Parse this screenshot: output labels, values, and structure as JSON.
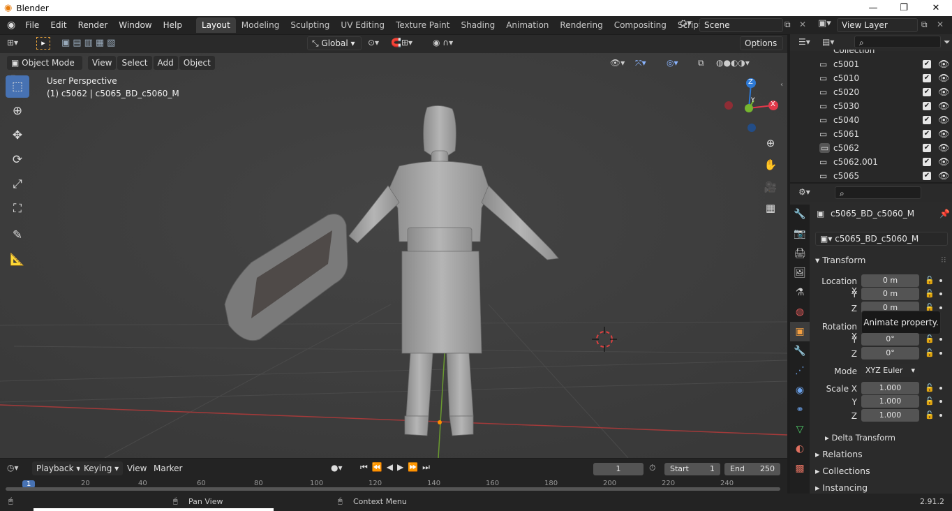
{
  "app": {
    "title": "Blender",
    "version": "2.91.2"
  },
  "menus": [
    "File",
    "Edit",
    "Render",
    "Window",
    "Help"
  ],
  "workspaces": [
    "Layout",
    "Modeling",
    "Sculpting",
    "UV Editing",
    "Texture Paint",
    "Shading",
    "Animation",
    "Rendering",
    "Compositing",
    "Scripting"
  ],
  "scene": {
    "scene_name": "Scene",
    "view_layer": "View Layer"
  },
  "toolbar": {
    "orientation": "Global",
    "options_label": "Options"
  },
  "viewport_header": {
    "mode": "Object Mode",
    "menus": [
      "View",
      "Select",
      "Add",
      "Object"
    ]
  },
  "viewport": {
    "perspective": "User Perspective",
    "object_info": "(1) c5062 | c5065_BD_c5060_M",
    "gizmo": {
      "z": "Z",
      "y": "Y",
      "x": "X"
    }
  },
  "outliner": {
    "top_partial": "Collection",
    "items": [
      "c5001",
      "c5010",
      "c5020",
      "c5030",
      "c5040",
      "c5061",
      "c5062",
      "c5062.001",
      "c5065"
    ]
  },
  "properties": {
    "object_name": "c5065_BD_c5060_M",
    "data_name": "c5065_BD_c5060_M",
    "transform_label": "Transform",
    "location_label": "Location X",
    "loc_x": "0 m",
    "loc_y": "0 m",
    "loc_z": "0 m",
    "rotation_label": "Rotation X",
    "rot_y": "0°",
    "rot_z": "0°",
    "mode_label": "Mode",
    "mode_value": "XYZ Euler",
    "scale_label": "Scale X",
    "scale_x": "1.000",
    "scale_y": "1.000",
    "scale_z": "1.000",
    "y_label": "Y",
    "z_label": "Z",
    "delta": "Delta Transform",
    "relations": "Relations",
    "collections": "Collections",
    "instancing": "Instancing",
    "tooltip": "Animate property."
  },
  "timeline": {
    "menus": [
      "Playback",
      "Keying",
      "View",
      "Marker"
    ],
    "current_frame": "1",
    "start_label": "Start",
    "start": "1",
    "end_label": "End",
    "end": "250",
    "ruler": [
      "1",
      "20",
      "40",
      "60",
      "80",
      "100",
      "120",
      "140",
      "160",
      "180",
      "200",
      "220",
      "240"
    ]
  },
  "status": {
    "pan": "Pan View",
    "context": "Context Menu",
    "version": "2.91.2"
  },
  "colors": {
    "accent": "#4772b3",
    "axis_x": "#e2394a",
    "axis_y": "#76b62f",
    "axis_z": "#2e7ad6"
  }
}
